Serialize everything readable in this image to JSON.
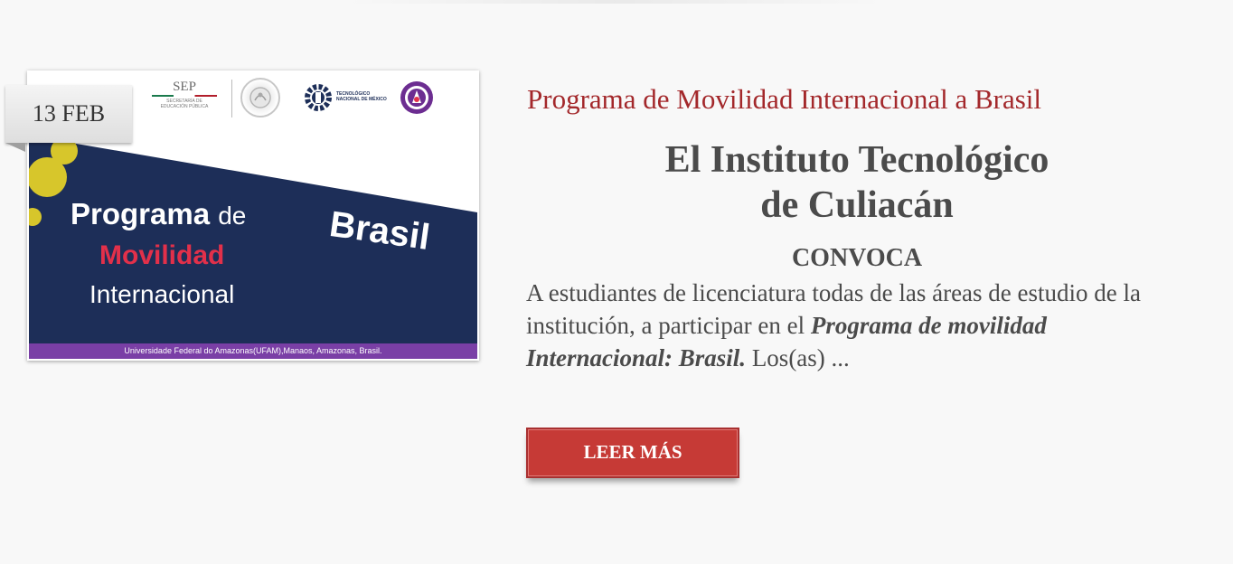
{
  "post": {
    "date": "13 FEB",
    "title": "Programa de Movilidad Internacional a Brasil",
    "headline_line1": "El Instituto Tecnológico",
    "headline_line2": "de Culiacán",
    "convoca": "CONVOCA",
    "excerpt_start": "A estudiantes de licenciatura todas de las áreas de estudio de la institución, a participar en el ",
    "excerpt_emphasis": "Programa de movilidad Internacional: Brasil.",
    "excerpt_end": " Los(as) ...",
    "read_more_label": "LEER MÁS"
  },
  "banner": {
    "line1_a": "Programa",
    "line1_b": "de",
    "line2": "Movilidad",
    "line3": "Internacional",
    "country": "Brasil",
    "footer": "Universidade Federal do Amazonas(UFAM),Manaos, Amazonas, Brasil.",
    "sep_title": "SEP",
    "sep_sub1": "SECRETARÍA DE",
    "sep_sub2": "EDUCACIÓN PÚBLICA",
    "tecnm_line1": "TECNOLÓGICO",
    "tecnm_line2": "NACIONAL DE MÉXICO"
  },
  "colors": {
    "title_red": "#a3282b",
    "button_red": "#c63a36",
    "banner_navy": "#1d2e58",
    "banner_purple": "#7a3fa6",
    "banner_pink": "#e2304a",
    "dot_yellow": "#d7c62b",
    "text_gray": "#4b4b4b"
  },
  "icons": {
    "seal": "mexican-coat-of-arms-icon",
    "tecnm": "gear-logo-icon",
    "itc": "itc-logo-icon"
  }
}
